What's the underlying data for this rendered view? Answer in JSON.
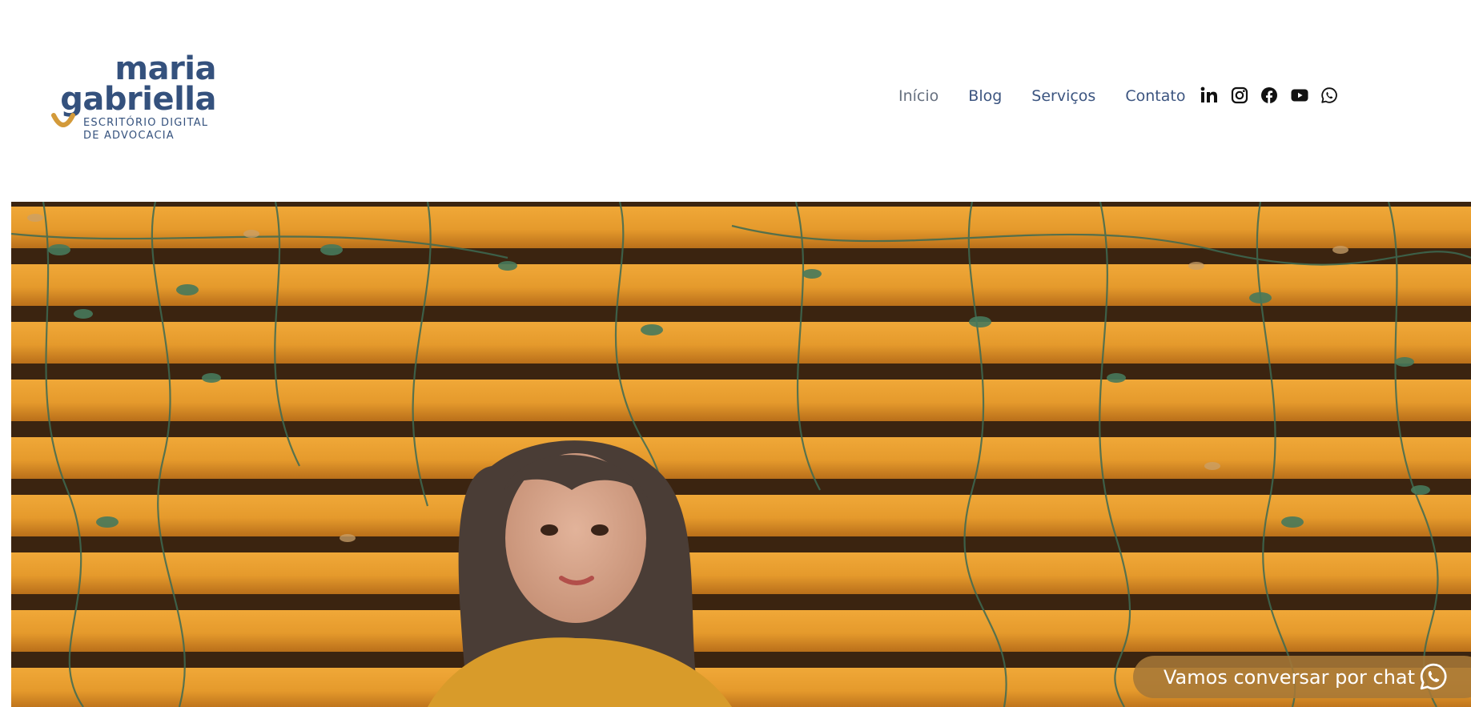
{
  "brand": {
    "name_line1": "maria",
    "name_line2": "gabriella",
    "tagline_line1": "ESCRITÓRIO DIGITAL",
    "tagline_line2": "DE ADVOCACIA",
    "primary_color": "#34517d",
    "accent_color": "#d39a3a"
  },
  "nav": {
    "items": [
      {
        "label": "Início"
      },
      {
        "label": "Blog"
      },
      {
        "label": "Serviços"
      },
      {
        "label": "Contato"
      }
    ]
  },
  "social": {
    "icons": [
      "linkedin-icon",
      "instagram-icon",
      "facebook-icon",
      "youtube-icon",
      "whatsapp-icon"
    ]
  },
  "hero": {
    "image": "portrait-photo-wooden-fence-with-vines"
  },
  "chat": {
    "label": "Vamos conversar por chat",
    "icon": "whatsapp-icon"
  }
}
